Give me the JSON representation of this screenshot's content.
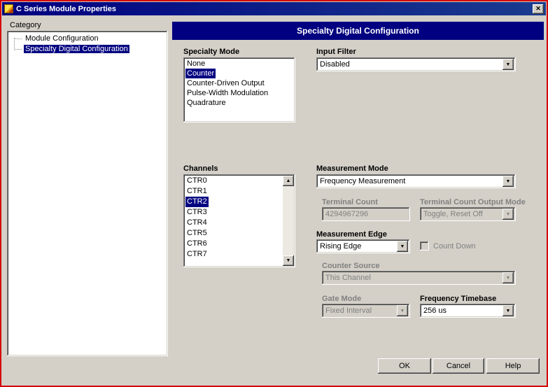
{
  "window": {
    "title": "C Series Module Properties"
  },
  "icons": {
    "close": "✕",
    "dropdown": "▼",
    "scroll_up": "▲",
    "scroll_down": "▼"
  },
  "category_panel": {
    "label": "Category",
    "items": [
      {
        "label": "Module Configuration"
      },
      {
        "label": "Specialty Digital Configuration"
      }
    ],
    "selected": "Specialty Digital Configuration"
  },
  "header": {
    "title": "Specialty Digital Configuration"
  },
  "specialty_mode": {
    "label": "Specialty Mode",
    "items": [
      "None",
      "Counter",
      "Counter-Driven Output",
      "Pulse-Width Modulation",
      "Quadrature"
    ],
    "selected": "Counter"
  },
  "input_filter": {
    "label": "Input Filter",
    "value": "Disabled"
  },
  "channels": {
    "label": "Channels",
    "items": [
      "CTR0",
      "CTR1",
      "CTR2",
      "CTR3",
      "CTR4",
      "CTR5",
      "CTR6",
      "CTR7"
    ],
    "selected": "CTR2"
  },
  "measurement_mode": {
    "label": "Measurement Mode",
    "value": "Frequency Measurement"
  },
  "terminal_count": {
    "label": "Terminal Count",
    "value": "4294967296",
    "disabled": true
  },
  "terminal_count_output_mode": {
    "label": "Terminal Count Output Mode",
    "value": "Toggle, Reset Off",
    "disabled": true
  },
  "measurement_edge": {
    "label": "Measurement Edge",
    "value": "Rising Edge"
  },
  "count_down": {
    "label": "Count Down",
    "checked": false,
    "disabled": true
  },
  "counter_source": {
    "label": "Counter Source",
    "value": "This Channel",
    "disabled": true
  },
  "gate_mode": {
    "label": "Gate Mode",
    "value": "Fixed Interval",
    "disabled": true
  },
  "frequency_timebase": {
    "label": "Frequency Timebase",
    "value": "256 us"
  },
  "buttons": {
    "ok": "OK",
    "cancel": "Cancel",
    "help": "Help"
  },
  "colors": {
    "titlebar": "#000080",
    "selection": "#000080",
    "dialog_bg": "#d4d0c8",
    "frame": "#d40000"
  }
}
